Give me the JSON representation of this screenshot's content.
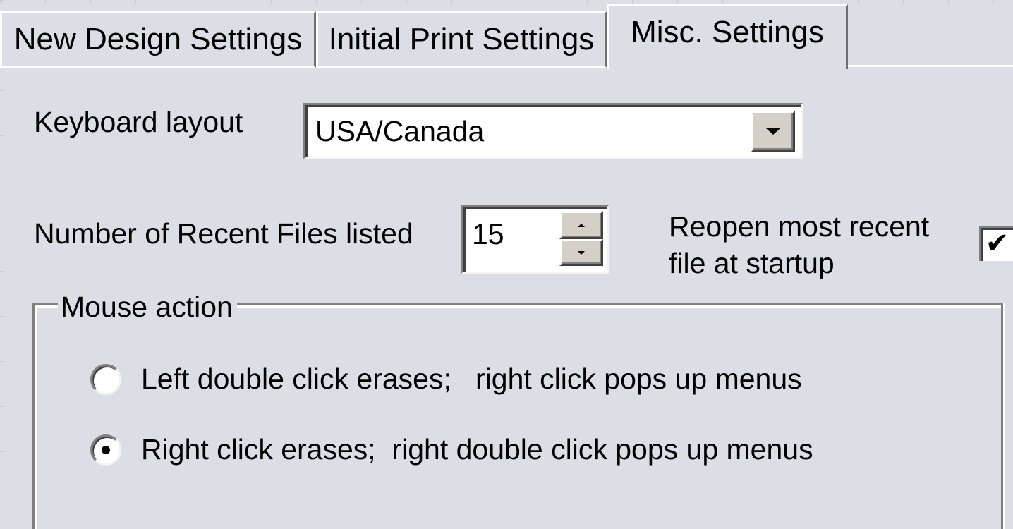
{
  "tabs": [
    {
      "label": "New Design Settings",
      "active": false
    },
    {
      "label": "Initial Print Settings",
      "active": false
    },
    {
      "label": "Misc. Settings",
      "active": true
    }
  ],
  "keyboard": {
    "label": "Keyboard layout",
    "value": "USA/Canada"
  },
  "recent_files": {
    "label": "Number of Recent Files listed",
    "value": "15"
  },
  "reopen": {
    "label_line1": "Reopen most recent",
    "label_line2": "file at startup",
    "checked": true,
    "check_glyph": "✔"
  },
  "mouse_action": {
    "legend": "Mouse action",
    "options": [
      {
        "label": "Left double click erases;   right click pops up menus",
        "selected": false
      },
      {
        "label": "Right click erases;  right double click pops up menus",
        "selected": true
      }
    ]
  },
  "colors": {
    "background": "#dcdde5",
    "field": "#ffffff"
  }
}
